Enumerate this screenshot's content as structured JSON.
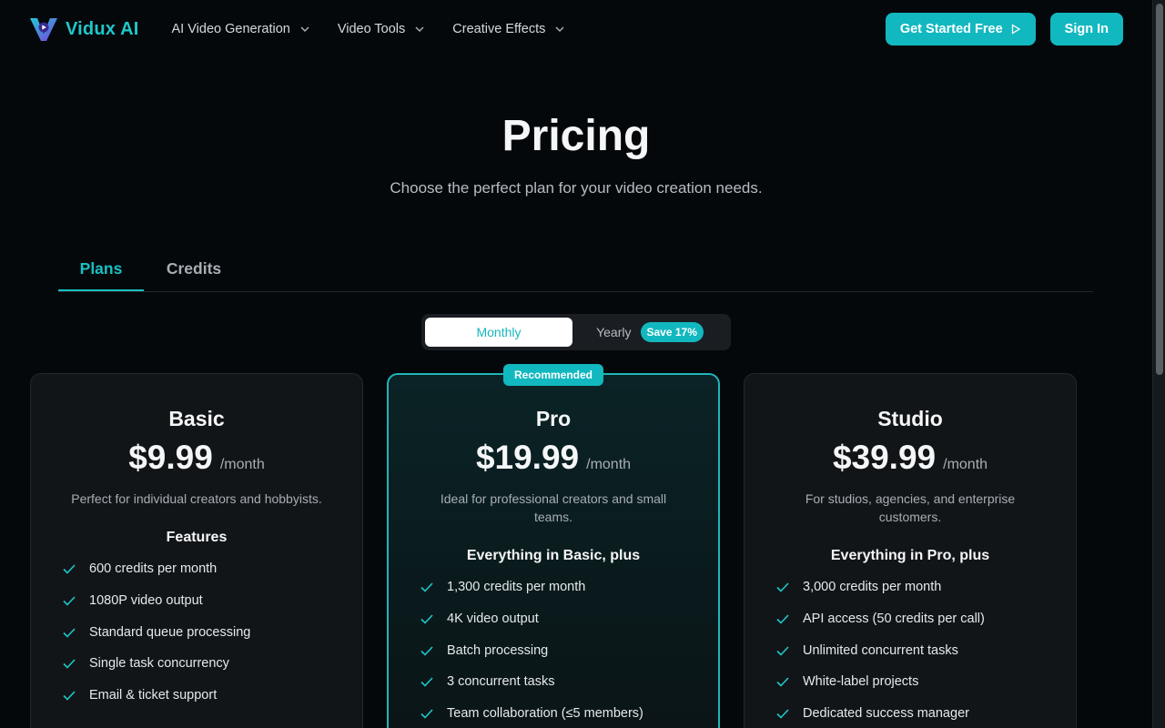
{
  "brand": {
    "name": "Vidux AI",
    "accent": "#12b8bf"
  },
  "nav": {
    "items": [
      {
        "label": "AI Video Generation",
        "icon": "chevron-down-icon"
      },
      {
        "label": "Video Tools",
        "icon": "chevron-down-icon"
      },
      {
        "label": "Creative Effects",
        "icon": "chevron-down-icon"
      }
    ],
    "get_started": "Get Started Free",
    "get_started_icon": "play-outline-icon",
    "sign_in": "Sign In"
  },
  "hero": {
    "title": "Pricing",
    "subtitle": "Choose the perfect plan for your video creation needs."
  },
  "tabs": [
    {
      "label": "Plans",
      "active": true
    },
    {
      "label": "Credits",
      "active": false
    }
  ],
  "billing": {
    "monthly": "Monthly",
    "yearly": "Yearly",
    "save_badge": "Save 17%",
    "selected": "Monthly"
  },
  "plans": [
    {
      "name": "Basic",
      "price": "$9.99",
      "per": "/month",
      "description": "Perfect for individual creators and hobbyists.",
      "features_heading": "Features",
      "features": [
        "600 credits per month",
        "1080P video output",
        "Standard queue processing",
        "Single task concurrency",
        "Email & ticket support"
      ]
    },
    {
      "name": "Pro",
      "badge": "Recommended",
      "price": "$19.99",
      "per": "/month",
      "description": "Ideal for professional creators and small teams.",
      "features_heading": "Everything in Basic, plus",
      "features": [
        "1,300 credits per month",
        "4K video output",
        "Batch processing",
        "3 concurrent tasks",
        "Team collaboration (≤5 members)"
      ]
    },
    {
      "name": "Studio",
      "price": "$39.99",
      "per": "/month",
      "description": "For studios, agencies, and enterprise customers.",
      "features_heading": "Everything in Pro, plus",
      "features": [
        "3,000 credits per month",
        "API access (50 credits per call)",
        "Unlimited concurrent tasks",
        "White-label projects",
        "Dedicated success manager"
      ]
    }
  ]
}
